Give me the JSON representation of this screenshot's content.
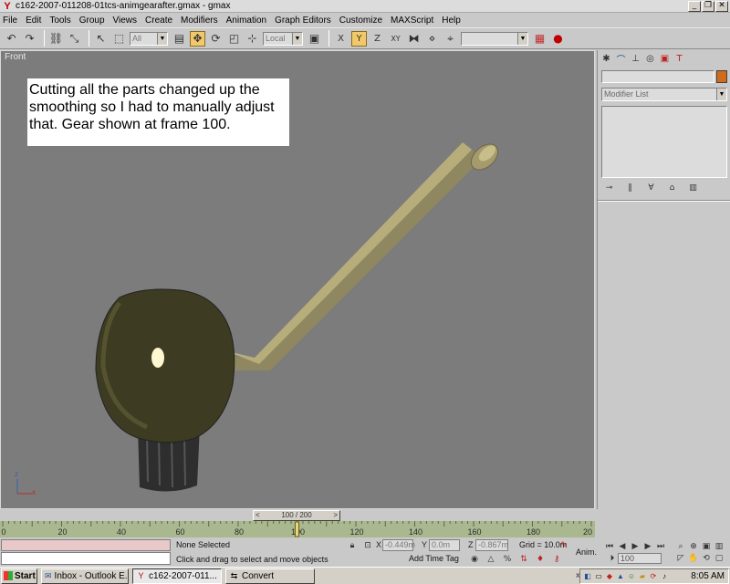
{
  "window": {
    "title": "c162-2007-011208-01tcs-animgearafter.gmax - gmax",
    "app_icon": "gmax-logo-icon",
    "buttons": [
      "_",
      "❐",
      "✕"
    ]
  },
  "menu": [
    "File",
    "Edit",
    "Tools",
    "Group",
    "Views",
    "Create",
    "Modifiers",
    "Animation",
    "Graph Editors",
    "Customize",
    "MAXScript",
    "Help"
  ],
  "toolbar": {
    "selection_filter": "All",
    "reference_coord": "Local",
    "named_selection": "",
    "icons": [
      "undo-icon",
      "redo-icon",
      "link-icon",
      "unlink-icon",
      "select-icon",
      "select-region-icon",
      "select-by-name-icon",
      "move-icon",
      "rotate-icon",
      "scale-icon",
      "pivot-icon",
      "restrict-x-icon",
      "restrict-y-icon",
      "restrict-z-icon",
      "restrict-xy-icon",
      "mirror-icon",
      "align-icon",
      "snap-icon",
      "material-editor-icon",
      "render-icon"
    ]
  },
  "viewport": {
    "label": "Front",
    "annotation": "Cutting all the parts changed up the smoothing so I had to manually adjust that.  Gear shown at frame 100.",
    "axis": {
      "x": "x",
      "z": "z"
    }
  },
  "command_panel": {
    "tabs": [
      "create-icon",
      "modify-icon",
      "hierarchy-icon",
      "motion-icon",
      "display-icon",
      "utilities-icon"
    ],
    "object_name": "",
    "object_color": "#d16b1c",
    "modifier_list": "Modifier List",
    "stack_tools": [
      "pin-stack-icon",
      "show-end-result-icon",
      "make-unique-icon",
      "remove-modifier-icon",
      "configure-modifier-sets-icon"
    ]
  },
  "time": {
    "slider_label": "100 / 200",
    "current_frame": 100,
    "total_frames": 200,
    "ticks": [
      "0",
      "20",
      "40",
      "60",
      "80",
      "100",
      "120",
      "140",
      "160",
      "180",
      "20"
    ]
  },
  "status": {
    "selection": "None Selected",
    "prompt": "Click and drag to select and move objects",
    "x_label": "X",
    "x_value": "-0.449m",
    "y_label": "Y",
    "y_value": "0.0m",
    "z_label": "Z",
    "z_value": "-0.867m",
    "grid": "Grid = 10.0m",
    "time_tag": "Add Time Tag",
    "anim_label": "Anim.",
    "frame_value": "100"
  },
  "taskbar": {
    "start": "Start",
    "buttons": [
      {
        "label": "Inbox - Outlook E...",
        "icon": "outlook-icon",
        "pressed": false
      },
      {
        "label": "c162-2007-011...",
        "icon": "gmax-logo-icon",
        "pressed": true
      },
      {
        "label": "Convert",
        "icon": "convert-icon",
        "pressed": false
      }
    ],
    "clock": "8:05 AM"
  },
  "colors": {
    "viewport_bg": "#7c7c7c",
    "gear_dark": "#3c3a22",
    "shaft": "#a49a6c",
    "accent_orange": "#d16b1c",
    "track_bg": "#aab88f"
  }
}
